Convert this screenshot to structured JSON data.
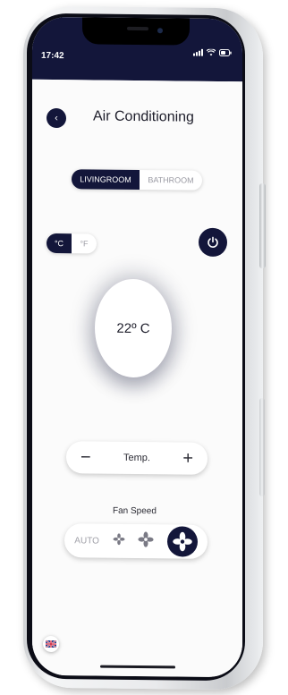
{
  "status_bar": {
    "time": "17:42"
  },
  "header": {
    "title": "Air Conditioning"
  },
  "room_selector": {
    "options": [
      "LIVINGROOM",
      "BATHROOM"
    ],
    "selected": "LIVINGROOM"
  },
  "unit_selector": {
    "options": [
      "°C",
      "°F"
    ],
    "selected": "°C"
  },
  "temperature": {
    "display": "22º C",
    "control_label": "Temp.",
    "minus_label": "−",
    "plus_label": "+"
  },
  "fan": {
    "label": "Fan Speed",
    "auto_label": "AUTO",
    "levels": 3,
    "selected_level": 3
  },
  "colors": {
    "accent": "#13163a",
    "background": "#fbfbfb"
  },
  "icons": {
    "back": "chevron-left-icon",
    "power": "power-icon",
    "fan": "fan-icon",
    "language": "uk-flag-icon"
  }
}
